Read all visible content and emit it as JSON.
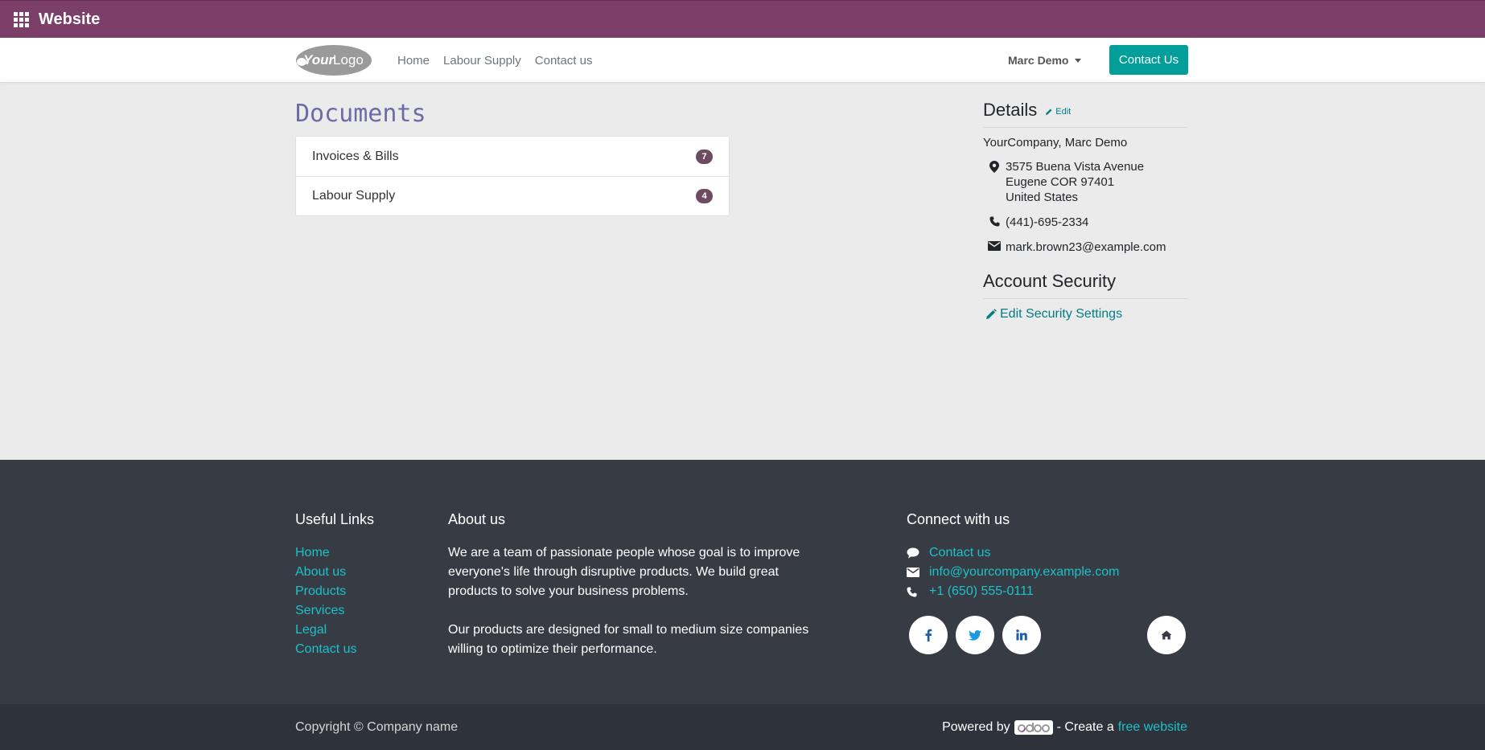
{
  "appbar": {
    "title": "Website",
    "apps_icon": "apps-grid-icon"
  },
  "header": {
    "logo_text": "YourLogo",
    "nav": [
      {
        "label": "Home"
      },
      {
        "label": "Labour Supply"
      },
      {
        "label": "Contact us"
      }
    ],
    "user_menu": "Marc Demo",
    "cta_label": "Contact Us"
  },
  "documents": {
    "title": "Documents",
    "items": [
      {
        "label": "Invoices & Bills",
        "count": "7"
      },
      {
        "label": "Labour Supply",
        "count": "4"
      }
    ]
  },
  "details": {
    "title": "Details",
    "edit_label": "Edit",
    "company": "YourCompany, Marc Demo",
    "address": [
      "3575 Buena Vista Avenue",
      "Eugene COR 97401",
      "United States"
    ],
    "phone": "(441)-695-2334",
    "email": "mark.brown23@example.com"
  },
  "security": {
    "title": "Account Security",
    "link": "Edit Security Settings"
  },
  "footer": {
    "useful_links_title": "Useful Links",
    "useful_links": [
      "Home",
      "About us",
      "Products",
      "Services",
      "Legal",
      "Contact us"
    ],
    "about_title": "About us",
    "about_p1": "We are a team of passionate people whose goal is to improve everyone's life through disruptive products. We build great products to solve your business problems.",
    "about_p2": "Our products are designed for small to medium size companies willing to optimize their performance.",
    "connect_title": "Connect with us",
    "connect": [
      {
        "icon": "chat-icon",
        "label": "Contact us"
      },
      {
        "icon": "envelope-icon",
        "label": "info@yourcompany.example.com"
      },
      {
        "icon": "phone-icon",
        "label": "+1 (650) 555-0111"
      }
    ],
    "social": [
      "facebook-icon",
      "twitter-icon",
      "linkedin-icon",
      "home-icon"
    ]
  },
  "copyright": {
    "text": "Copyright © Company name",
    "powered_by": "Powered by",
    "odoo": "odoo",
    "create": "- Create a",
    "free_website": "free website"
  },
  "colors": {
    "appbar": "#7c3f69",
    "accent": "#019e9a",
    "link": "#017e84",
    "footer_link": "#1cc1c9",
    "badge": "#6d4b60",
    "doc_title": "#6e6aa5",
    "footer_bg": "#373c44"
  }
}
